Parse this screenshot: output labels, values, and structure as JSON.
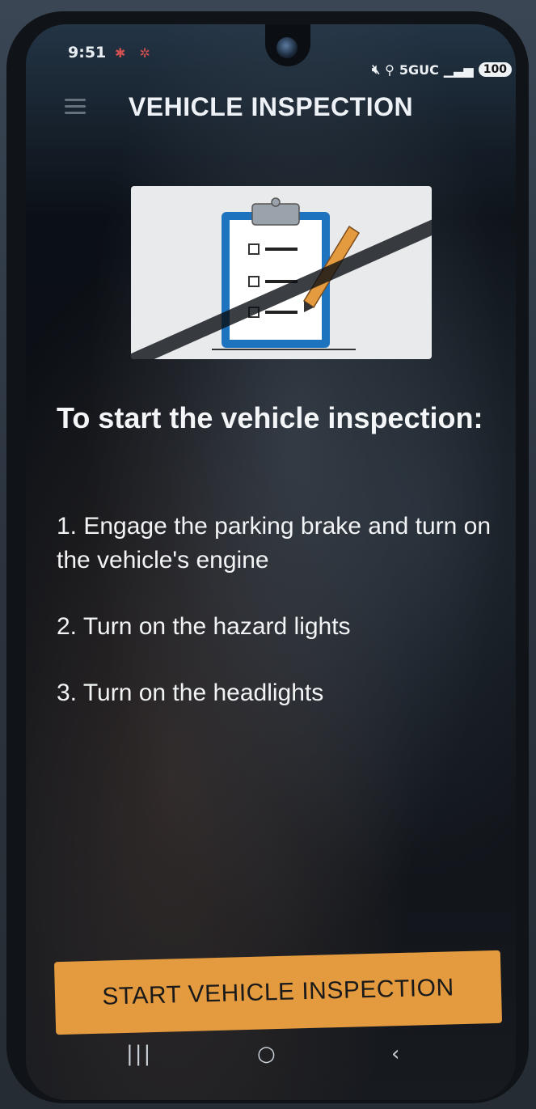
{
  "status_bar": {
    "time": "9:51",
    "left_icons": "✱ ✲",
    "network": "5GUC",
    "battery": "100"
  },
  "app": {
    "title": "VEHICLE INSPECTION"
  },
  "illustration": {
    "icon": "clipboard-checklist-icon",
    "accent_color": "#1e73be",
    "pencil_color": "#e49a3e"
  },
  "content": {
    "heading": "To start the vehicle inspection:",
    "steps": [
      "1. Engage the parking brake and turn on the vehicle's engine",
      "2. Turn on the hazard lights",
      "3. Turn on the headlights"
    ]
  },
  "cta": {
    "label": "START VEHICLE INSPECTION",
    "color": "#e49a3e"
  },
  "nav_bar": {
    "recent": "|||",
    "home": "○",
    "back": "‹"
  }
}
